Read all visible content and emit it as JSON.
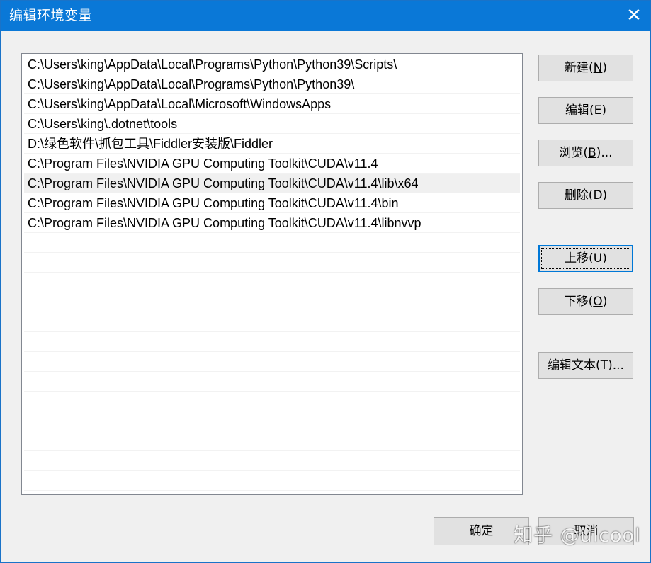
{
  "window": {
    "title": "编辑环境变量",
    "close_glyph": "✕"
  },
  "path_list": {
    "selected_index": 6,
    "items": [
      "C:\\Users\\king\\AppData\\Local\\Programs\\Python\\Python39\\Scripts\\",
      "C:\\Users\\king\\AppData\\Local\\Programs\\Python\\Python39\\",
      "C:\\Users\\king\\AppData\\Local\\Microsoft\\WindowsApps",
      "C:\\Users\\king\\.dotnet\\tools",
      "D:\\绿色软件\\抓包工具\\Fiddler安装版\\Fiddler",
      "C:\\Program Files\\NVIDIA GPU Computing Toolkit\\CUDA\\v11.4",
      "C:\\Program Files\\NVIDIA GPU Computing Toolkit\\CUDA\\v11.4\\lib\\x64",
      "C:\\Program Files\\NVIDIA GPU Computing Toolkit\\CUDA\\v11.4\\bin",
      "C:\\Program Files\\NVIDIA GPU Computing Toolkit\\CUDA\\v11.4\\libnvvp"
    ],
    "empty_rows": 13
  },
  "buttons": {
    "new": {
      "prefix": "新建(",
      "key": "N",
      "suffix": ")"
    },
    "edit": {
      "prefix": "编辑(",
      "key": "E",
      "suffix": ")"
    },
    "browse": {
      "prefix": "浏览(",
      "key": "B",
      "suffix": ")..."
    },
    "delete": {
      "prefix": "删除(",
      "key": "D",
      "suffix": ")"
    },
    "move_up": {
      "prefix": "上移(",
      "key": "U",
      "suffix": ")"
    },
    "move_down": {
      "prefix": "下移(",
      "key": "O",
      "suffix": ")"
    },
    "edit_text": {
      "prefix": "编辑文本(",
      "key": "T",
      "suffix": ")..."
    },
    "ok": "确定",
    "cancel": "取消"
  },
  "watermark": "知乎 @ulcool",
  "colors": {
    "titlebar": "#0a78d7",
    "focus_border": "#0078d7",
    "selected_row": "#f0f0f0"
  }
}
